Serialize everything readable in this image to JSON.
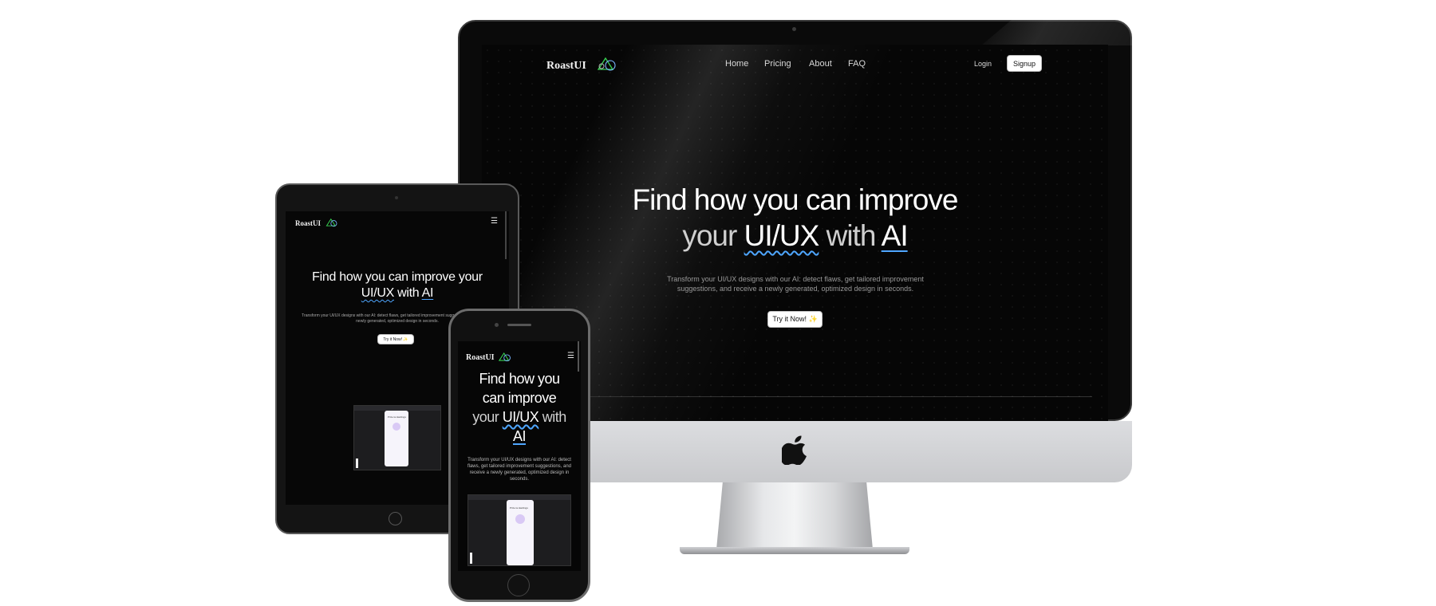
{
  "site": {
    "brand": "RoastUI",
    "nav": [
      "Home",
      "Pricing",
      "About",
      "FAQ"
    ],
    "login": "Login",
    "signup": "Signup",
    "hero": {
      "line1": "Find how you can improve",
      "line2_prefix": "your",
      "highlight1": "UI/UX",
      "line2_mid": "with",
      "highlight2": "AI"
    },
    "subtitle": "Transform your UI/UX designs with our AI: detect flaws, get tailored improvement suggestions, and receive a newly generated, optimized design in seconds.",
    "cta": "Try it Now! ✨",
    "tablet_hero_line1": "Find how you can improve your",
    "phone_hero_lines": [
      "Find how you",
      "can improve"
    ],
    "mini_app_title": "Prize la Hardings"
  },
  "colors": {
    "accent_underline": "#4ea6ff",
    "logo_green": "#39d353",
    "screen_bg": "#060606"
  },
  "icons": [
    "apple-logo-icon",
    "logo-mark-icon",
    "hamburger-menu-icon"
  ]
}
